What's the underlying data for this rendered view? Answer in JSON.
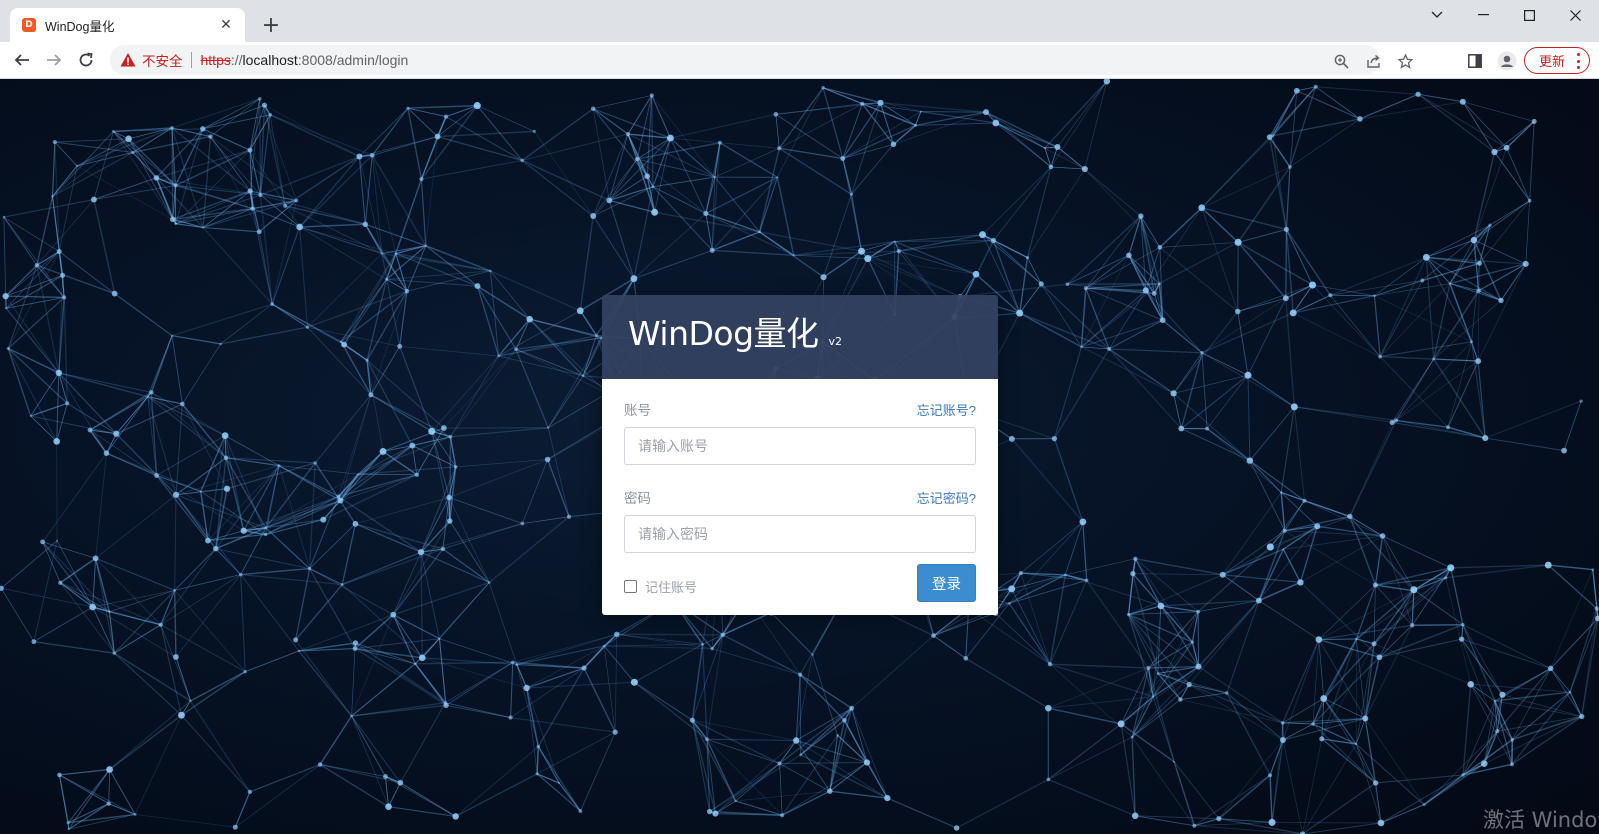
{
  "browser": {
    "tab_title": "WinDog量化",
    "tab_favicon_letter": "D",
    "new_tab_symbol": "+",
    "close_symbol": "✕",
    "security_label": "不安全",
    "url_scheme": "https",
    "url_separator": "://",
    "url_host": "localhost",
    "url_path": ":8008/admin/login",
    "update_label": "更新",
    "accent_color": "#c5221f"
  },
  "login": {
    "brand": "WinDog量化",
    "version": "v2",
    "account_label": "账号",
    "forgot_account": "忘记账号?",
    "account_placeholder": "请输入账号",
    "password_label": "密码",
    "forgot_password": "忘记密码?",
    "password_placeholder": "请输入密码",
    "remember_label": "记住账号",
    "submit_label": "登录",
    "header_color": "#344361",
    "button_color": "#3c8dcf"
  },
  "watermark": {
    "text": "激活 Windows"
  }
}
